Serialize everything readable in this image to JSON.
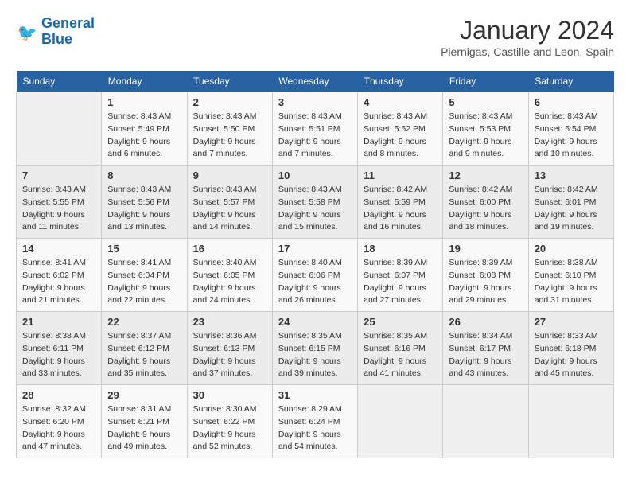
{
  "logo": {
    "line1": "General",
    "line2": "Blue"
  },
  "title": "January 2024",
  "subtitle": "Piernigas, Castille and Leon, Spain",
  "days_header": [
    "Sunday",
    "Monday",
    "Tuesday",
    "Wednesday",
    "Thursday",
    "Friday",
    "Saturday"
  ],
  "weeks": [
    [
      {
        "day": "",
        "info": ""
      },
      {
        "day": "1",
        "info": "Sunrise: 8:43 AM\nSunset: 5:49 PM\nDaylight: 9 hours\nand 6 minutes."
      },
      {
        "day": "2",
        "info": "Sunrise: 8:43 AM\nSunset: 5:50 PM\nDaylight: 9 hours\nand 7 minutes."
      },
      {
        "day": "3",
        "info": "Sunrise: 8:43 AM\nSunset: 5:51 PM\nDaylight: 9 hours\nand 7 minutes."
      },
      {
        "day": "4",
        "info": "Sunrise: 8:43 AM\nSunset: 5:52 PM\nDaylight: 9 hours\nand 8 minutes."
      },
      {
        "day": "5",
        "info": "Sunrise: 8:43 AM\nSunset: 5:53 PM\nDaylight: 9 hours\nand 9 minutes."
      },
      {
        "day": "6",
        "info": "Sunrise: 8:43 AM\nSunset: 5:54 PM\nDaylight: 9 hours\nand 10 minutes."
      }
    ],
    [
      {
        "day": "7",
        "info": "Sunrise: 8:43 AM\nSunset: 5:55 PM\nDaylight: 9 hours\nand 11 minutes."
      },
      {
        "day": "8",
        "info": "Sunrise: 8:43 AM\nSunset: 5:56 PM\nDaylight: 9 hours\nand 13 minutes."
      },
      {
        "day": "9",
        "info": "Sunrise: 8:43 AM\nSunset: 5:57 PM\nDaylight: 9 hours\nand 14 minutes."
      },
      {
        "day": "10",
        "info": "Sunrise: 8:43 AM\nSunset: 5:58 PM\nDaylight: 9 hours\nand 15 minutes."
      },
      {
        "day": "11",
        "info": "Sunrise: 8:42 AM\nSunset: 5:59 PM\nDaylight: 9 hours\nand 16 minutes."
      },
      {
        "day": "12",
        "info": "Sunrise: 8:42 AM\nSunset: 6:00 PM\nDaylight: 9 hours\nand 18 minutes."
      },
      {
        "day": "13",
        "info": "Sunrise: 8:42 AM\nSunset: 6:01 PM\nDaylight: 9 hours\nand 19 minutes."
      }
    ],
    [
      {
        "day": "14",
        "info": "Sunrise: 8:41 AM\nSunset: 6:02 PM\nDaylight: 9 hours\nand 21 minutes."
      },
      {
        "day": "15",
        "info": "Sunrise: 8:41 AM\nSunset: 6:04 PM\nDaylight: 9 hours\nand 22 minutes."
      },
      {
        "day": "16",
        "info": "Sunrise: 8:40 AM\nSunset: 6:05 PM\nDaylight: 9 hours\nand 24 minutes."
      },
      {
        "day": "17",
        "info": "Sunrise: 8:40 AM\nSunset: 6:06 PM\nDaylight: 9 hours\nand 26 minutes."
      },
      {
        "day": "18",
        "info": "Sunrise: 8:39 AM\nSunset: 6:07 PM\nDaylight: 9 hours\nand 27 minutes."
      },
      {
        "day": "19",
        "info": "Sunrise: 8:39 AM\nSunset: 6:08 PM\nDaylight: 9 hours\nand 29 minutes."
      },
      {
        "day": "20",
        "info": "Sunrise: 8:38 AM\nSunset: 6:10 PM\nDaylight: 9 hours\nand 31 minutes."
      }
    ],
    [
      {
        "day": "21",
        "info": "Sunrise: 8:38 AM\nSunset: 6:11 PM\nDaylight: 9 hours\nand 33 minutes."
      },
      {
        "day": "22",
        "info": "Sunrise: 8:37 AM\nSunset: 6:12 PM\nDaylight: 9 hours\nand 35 minutes."
      },
      {
        "day": "23",
        "info": "Sunrise: 8:36 AM\nSunset: 6:13 PM\nDaylight: 9 hours\nand 37 minutes."
      },
      {
        "day": "24",
        "info": "Sunrise: 8:35 AM\nSunset: 6:15 PM\nDaylight: 9 hours\nand 39 minutes."
      },
      {
        "day": "25",
        "info": "Sunrise: 8:35 AM\nSunset: 6:16 PM\nDaylight: 9 hours\nand 41 minutes."
      },
      {
        "day": "26",
        "info": "Sunrise: 8:34 AM\nSunset: 6:17 PM\nDaylight: 9 hours\nand 43 minutes."
      },
      {
        "day": "27",
        "info": "Sunrise: 8:33 AM\nSunset: 6:18 PM\nDaylight: 9 hours\nand 45 minutes."
      }
    ],
    [
      {
        "day": "28",
        "info": "Sunrise: 8:32 AM\nSunset: 6:20 PM\nDaylight: 9 hours\nand 47 minutes."
      },
      {
        "day": "29",
        "info": "Sunrise: 8:31 AM\nSunset: 6:21 PM\nDaylight: 9 hours\nand 49 minutes."
      },
      {
        "day": "30",
        "info": "Sunrise: 8:30 AM\nSunset: 6:22 PM\nDaylight: 9 hours\nand 52 minutes."
      },
      {
        "day": "31",
        "info": "Sunrise: 8:29 AM\nSunset: 6:24 PM\nDaylight: 9 hours\nand 54 minutes."
      },
      {
        "day": "",
        "info": ""
      },
      {
        "day": "",
        "info": ""
      },
      {
        "day": "",
        "info": ""
      }
    ]
  ]
}
